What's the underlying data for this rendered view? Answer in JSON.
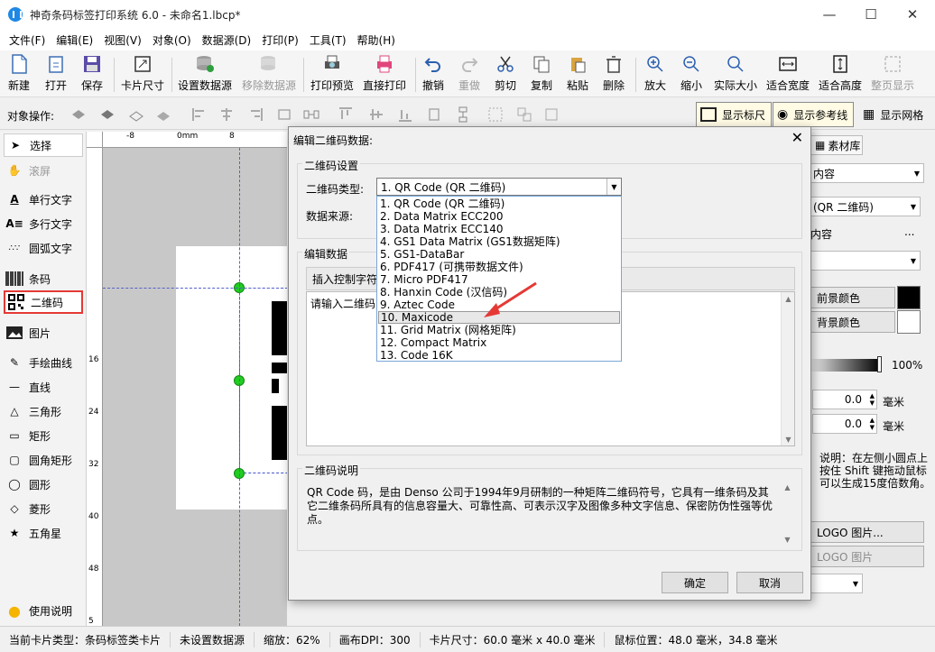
{
  "window": {
    "title": "神奇条码标签打印系统 6.0 - 未命名1.lbcp*"
  },
  "menu": [
    "文件(F)",
    "编辑(E)",
    "视图(V)",
    "对象(O)",
    "数据源(D)",
    "打印(P)",
    "工具(T)",
    "帮助(H)"
  ],
  "toolbar": {
    "new": "新建",
    "open": "打开",
    "save": "保存",
    "card_size": "卡片尺寸",
    "set_datasource": "设置数据源",
    "remove_datasource": "移除数据源",
    "print_preview": "打印预览",
    "direct_print": "直接打印",
    "undo": "撤销",
    "redo": "重做",
    "cut": "剪切",
    "copy": "复制",
    "paste": "粘贴",
    "delete": "删除",
    "zoom_in": "放大",
    "zoom_out": "缩小",
    "actual_size": "实际大小",
    "fit_width": "适合宽度",
    "fit_height": "适合高度",
    "full_page": "整页显示"
  },
  "ops": {
    "label": "对象操作:",
    "show_ruler": "显示标尺",
    "show_guides": "显示参考线",
    "show_grid": "显示网格"
  },
  "tools": {
    "select": "选择",
    "scroll": "滚屏",
    "single_text": "单行文字",
    "multi_text": "多行文字",
    "arc_text": "圆弧文字",
    "barcode": "条码",
    "qrcode": "二维码",
    "image": "图片",
    "freehand": "手绘曲线",
    "line": "直线",
    "triangle": "三角形",
    "rect": "矩形",
    "round_rect": "圆角矩形",
    "circle": "圆形",
    "diamond": "菱形",
    "star": "五角星",
    "help": "使用说明"
  },
  "ruler": {
    "h": [
      "-8",
      "0mm",
      "8"
    ],
    "v": [
      "16",
      "24",
      "32",
      "40",
      "48",
      "5"
    ]
  },
  "right_panel": {
    "tab_material": "素材库",
    "content_dropdown": "内容",
    "qr_type": "(QR 二维码)",
    "content_label": "内容",
    "content_ellipsis": "...",
    "fg_color": "前景颜色",
    "bg_color": "背景颜色",
    "opacity": "100%",
    "spin1_value": "0.0",
    "spin2_value": "0.0",
    "unit": "毫米",
    "hint": "说明：在左侧小圆点上按住 Shift 键拖动鼠标可以生成15度倍数角。",
    "logo_btn": "LOGO 图片...",
    "logo_btn2": "LOGO 图片"
  },
  "status": {
    "card_type": "当前卡片类型：条码标签类卡片",
    "datasource": "未设置数据源",
    "zoom": "缩放：62%",
    "dpi": "画布DPI：300",
    "card_size": "卡片尺寸：60.0 毫米 x 40.0 毫米",
    "mouse_pos": "鼠标位置：48.0 毫米，34.8 毫米"
  },
  "dialog": {
    "title": "编辑二维码数据:",
    "group_settings": "二维码设置",
    "type_label": "二维码类型:",
    "type_value": "1.  QR Code (QR 二维码)",
    "source_label": "数据来源:",
    "group_edit": "编辑数据",
    "insert_ctrl": "插入控制字符",
    "data_placeholder": "请输入二维码",
    "group_desc": "二维码说明",
    "desc": "QR Code 码，是由 Denso 公司于1994年9月研制的一种矩阵二维码符号，它具有一维条码及其它二维条码所具有的信息容量大、可靠性高、可表示汉字及图像多种文字信息、保密防伪性强等优点。",
    "ok": "确定",
    "cancel": "取消",
    "options": [
      "1.  QR Code (QR 二维码)",
      "2.  Data Matrix ECC200",
      "3.  Data Matrix ECC140",
      "4.  GS1 Data Matrix (GS1数据矩阵)",
      "5.  GS1-DataBar",
      "6.  PDF417 (可携带数据文件)",
      "7.  Micro PDF417",
      "8.  Hanxin Code (汉信码)",
      "9.  Aztec Code",
      "10.  Maxicode",
      "11.  Grid Matrix (网格矩阵)",
      "12.  Compact Matrix",
      "13.  Code 16K"
    ]
  }
}
